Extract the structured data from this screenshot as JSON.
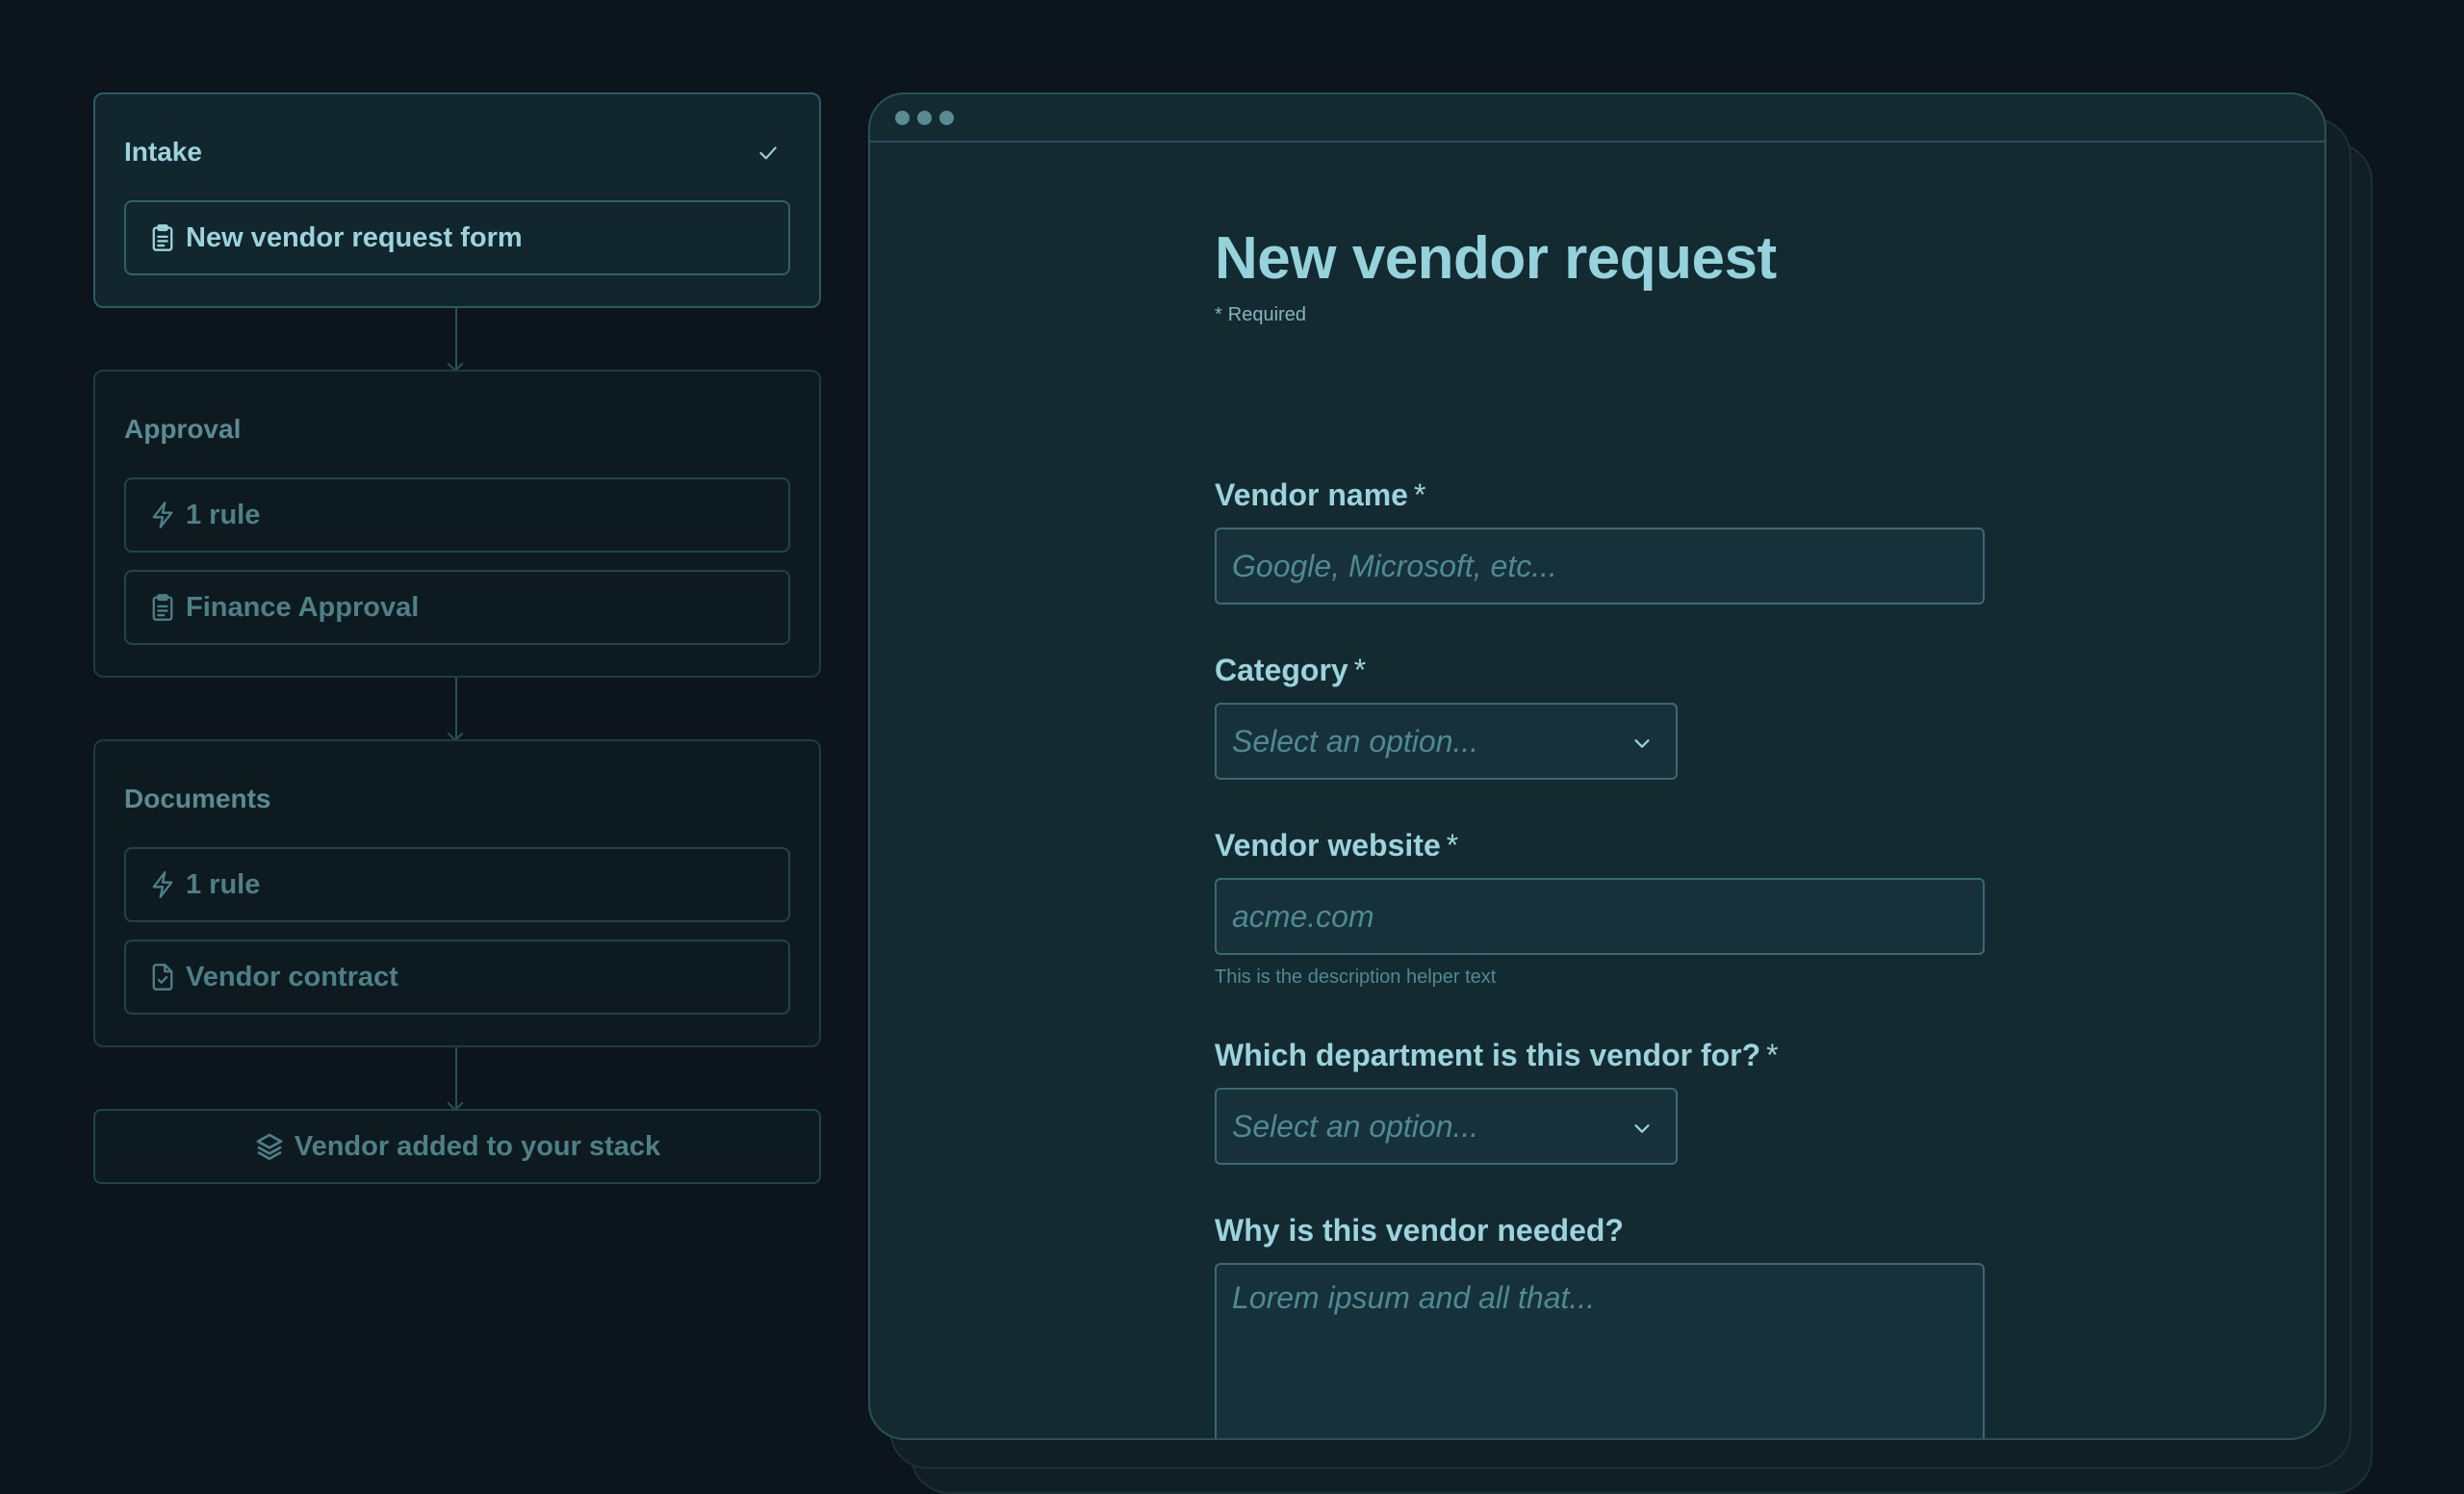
{
  "workflow": {
    "intake": {
      "title": "Intake",
      "step": "New vendor request form"
    },
    "approval": {
      "title": "Approval",
      "rule": "1 rule",
      "step": "Finance Approval"
    },
    "documents": {
      "title": "Documents",
      "rule": "1 rule",
      "step": "Vendor contract"
    },
    "final": "Vendor added to your stack"
  },
  "form": {
    "title": "New vendor request",
    "required_note": "Required",
    "required_star": "*",
    "vendor_name": {
      "label": "Vendor name",
      "placeholder": "Google, Microsoft, etc..."
    },
    "category": {
      "label": "Category",
      "placeholder": "Select an option..."
    },
    "vendor_website": {
      "label": "Vendor website",
      "placeholder": "acme.com",
      "helper": "This is the description helper text"
    },
    "department": {
      "label": "Which department is this vendor for?",
      "placeholder": "Select an option..."
    },
    "why_needed": {
      "label": "Why is this vendor needed?",
      "placeholder": "Lorem ipsum and all that..."
    }
  },
  "colors": {
    "background": "#0b151b",
    "accent": "#95d2dc",
    "muted": "#4f7f87",
    "border": "#2b5057"
  }
}
